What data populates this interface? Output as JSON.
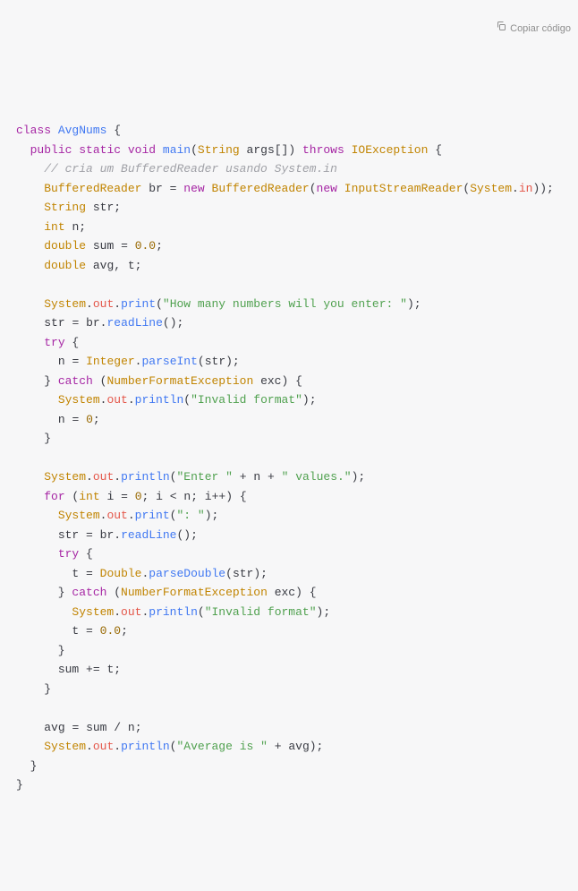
{
  "copy_label": "Copiar código",
  "code": {
    "kw_class": "class",
    "cls_name": "AvgNums",
    "kw_public": "public",
    "kw_static": "static",
    "kw_void": "void",
    "fn_main": "main",
    "type_String": "String",
    "param_args": "args[]",
    "kw_throws": "throws",
    "ex_IOException": "IOException",
    "cmt_line": "// cria um BufferedReader usando System.in",
    "type_BufferedReader": "BufferedReader",
    "var_br": "br",
    "op_eq": "=",
    "kw_new": "new",
    "type_InputStreamReader": "InputStreamReader",
    "sys": "System",
    "field_in": "in",
    "var_str": "str",
    "type_int": "int",
    "var_n": "n",
    "type_double": "double",
    "var_sum": "sum",
    "num_zero_d": "0.0",
    "var_avg": "avg",
    "var_t": "t",
    "field_out": "out",
    "fn_print": "print",
    "fn_println": "println",
    "str_howmany": "\"How many numbers will you enter: \"",
    "fn_readLine": "readLine",
    "kw_try": "try",
    "type_Integer": "Integer",
    "fn_parseInt": "parseInt",
    "kw_catch": "catch",
    "type_NFE": "NumberFormatException",
    "var_exc": "exc",
    "str_invalid": "\"Invalid format\"",
    "num_zero": "0",
    "str_enter": "\"Enter \"",
    "op_plus": "+",
    "str_values": "\" values.\"",
    "kw_for": "for",
    "var_i": "i",
    "op_lt": "<",
    "op_inc": "++",
    "str_colon": "\": \"",
    "type_Double": "Double",
    "fn_parseDouble": "parseDouble",
    "op_pluseq": "+=",
    "op_div": "/",
    "str_avg": "\"Average is \""
  }
}
